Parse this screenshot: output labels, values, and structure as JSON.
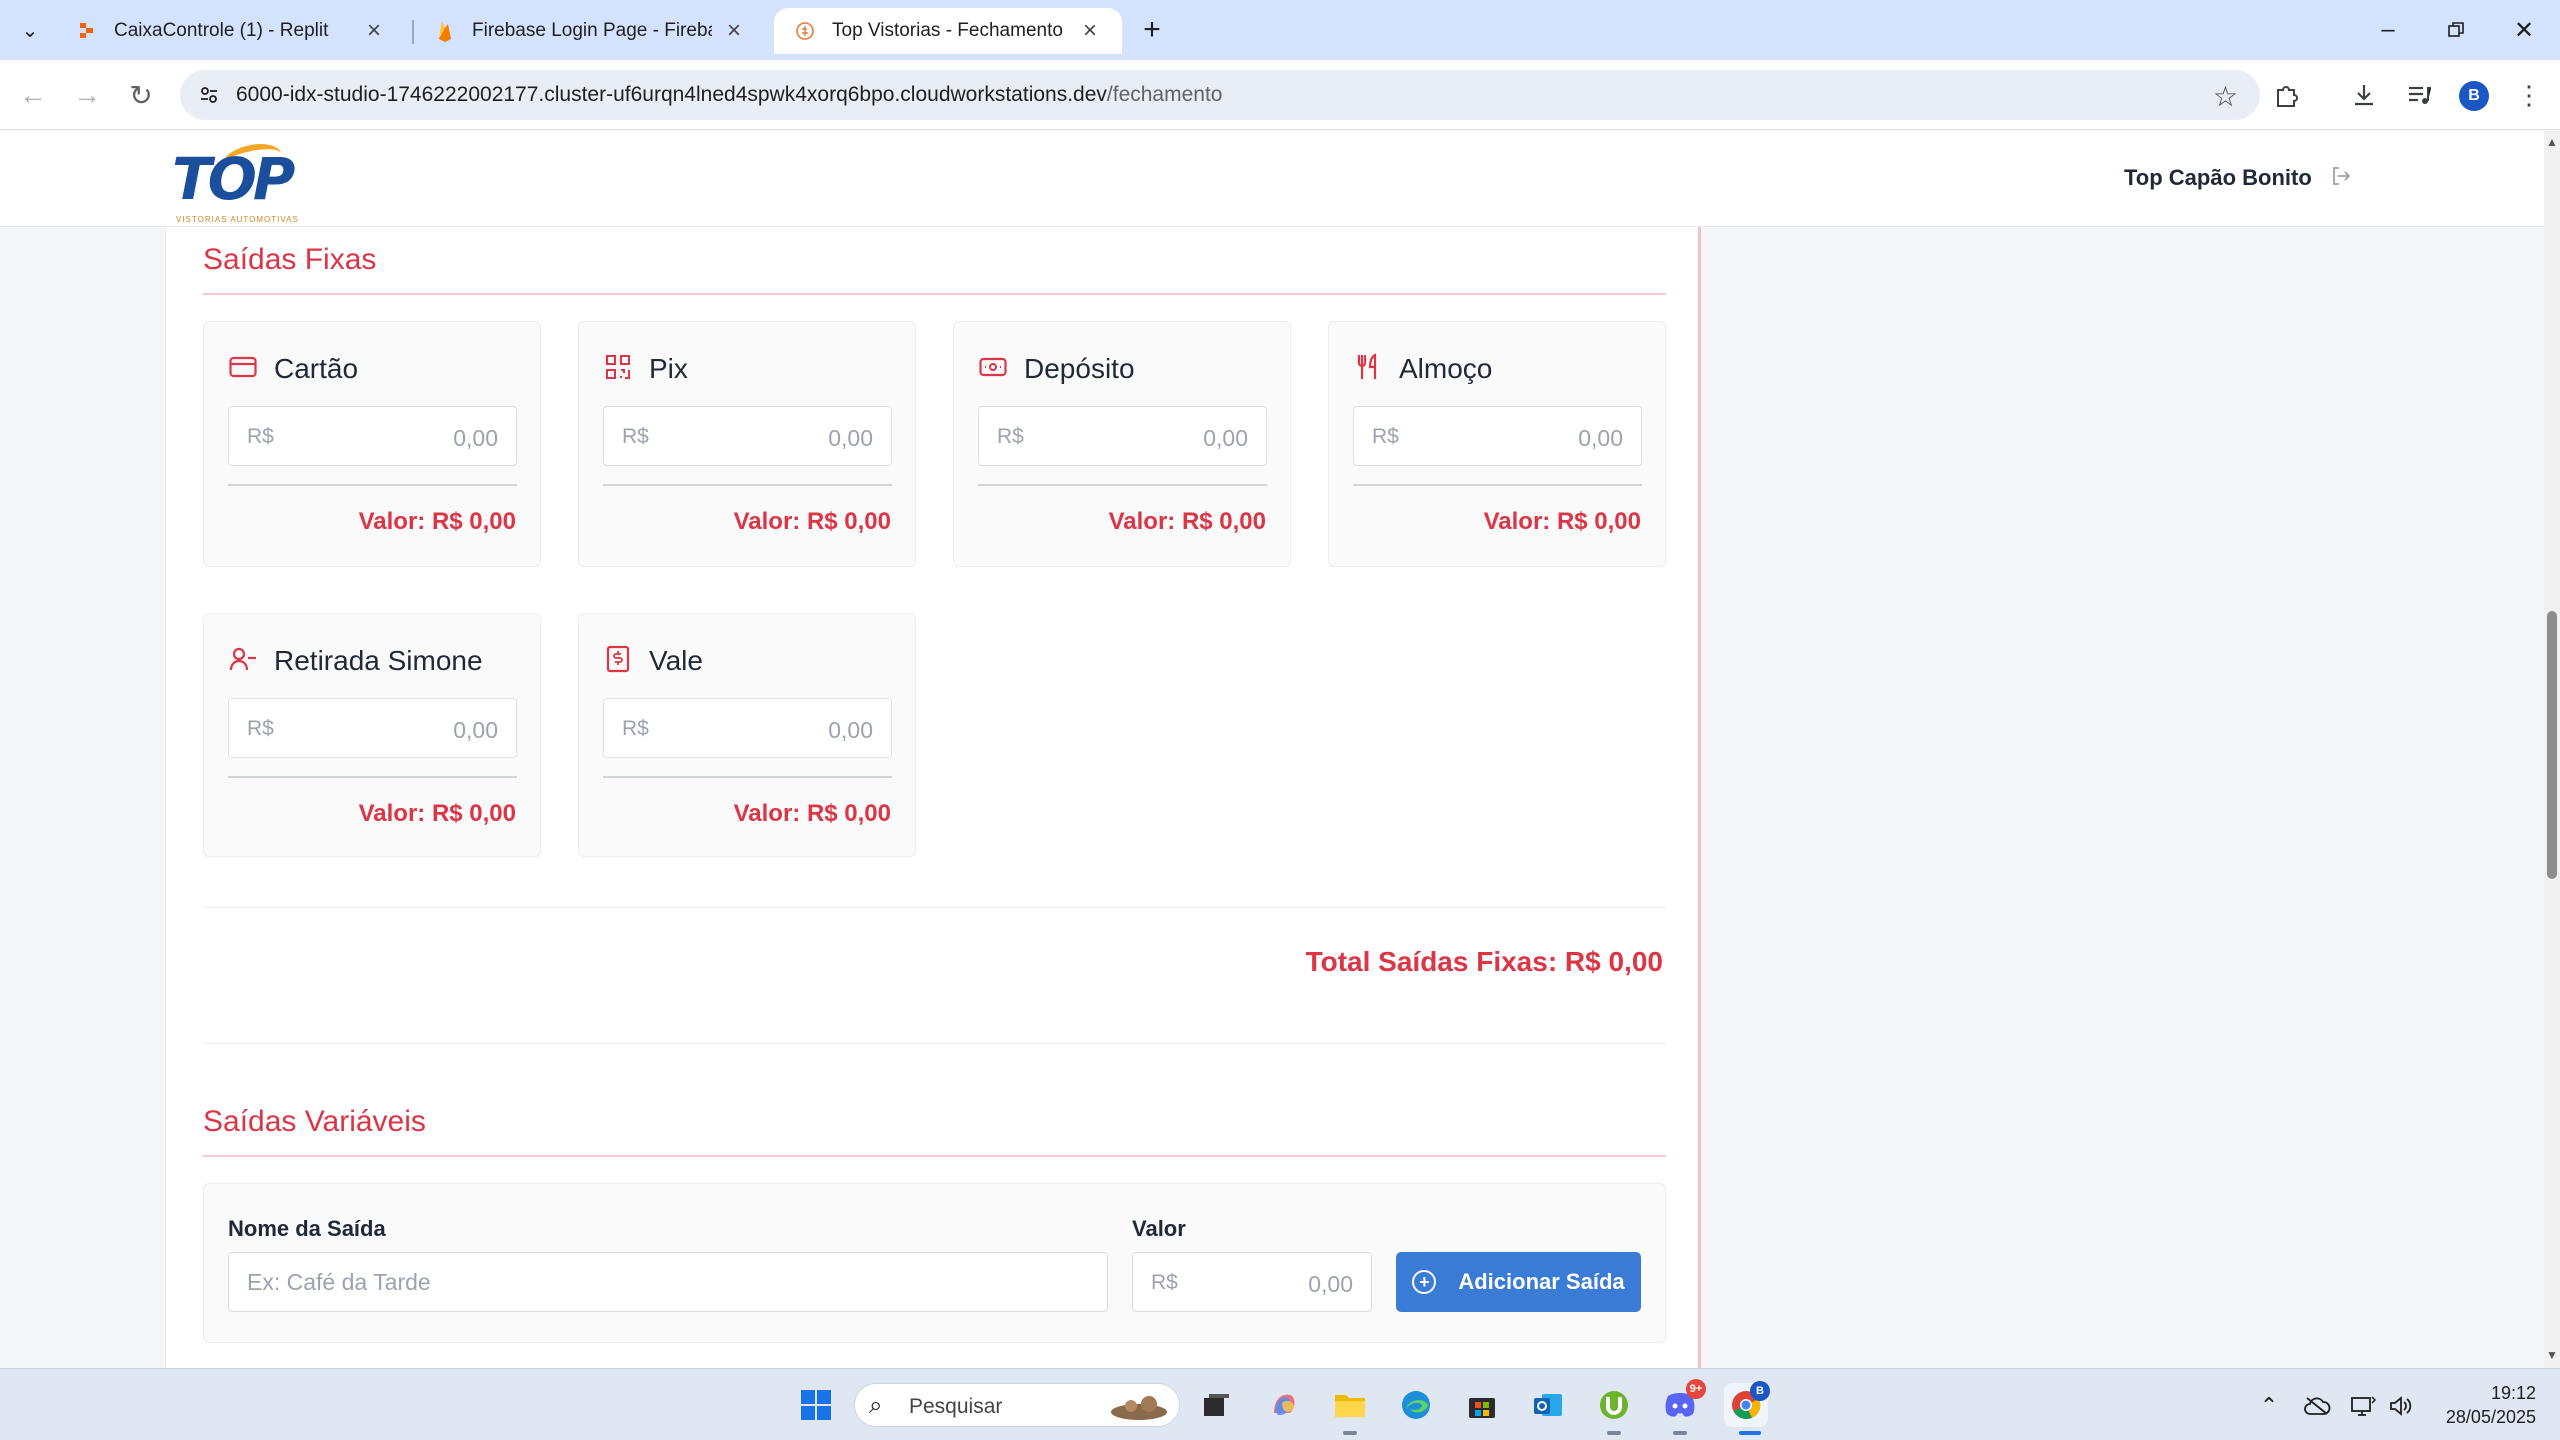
{
  "browser": {
    "tabs": [
      {
        "title": "CaixaControle (1) - Replit",
        "favicon": "replit-icon"
      },
      {
        "title": "Firebase Login Page - Firebase",
        "favicon": "firebase-icon"
      },
      {
        "title": "Top Vistorias - Fechamento de",
        "favicon": "page-icon",
        "active": true
      }
    ],
    "url_host": "6000-idx-studio-1746222002177.cluster-uf6urqn4lned4spwk4xorq6bpo.cloudworkstations.dev",
    "url_path": "/fechamento",
    "profile_initial": "B"
  },
  "header": {
    "logo_text": "TOP",
    "logo_tagline": "VISTORIAS AUTOMOTIVAS",
    "user_name": "Top Capão Bonito"
  },
  "saidas_fixas": {
    "title": "Saídas Fixas",
    "items": [
      {
        "name": "Cartão",
        "icon": "credit-card-icon",
        "currency": "R$",
        "amount": "0,00",
        "valor": "Valor: R$ 0,00"
      },
      {
        "name": "Pix",
        "icon": "qr-code-icon",
        "currency": "R$",
        "amount": "0,00",
        "valor": "Valor: R$ 0,00"
      },
      {
        "name": "Depósito",
        "icon": "banknote-icon",
        "currency": "R$",
        "amount": "0,00",
        "valor": "Valor: R$ 0,00"
      },
      {
        "name": "Almoço",
        "icon": "utensils-icon",
        "currency": "R$",
        "amount": "0,00",
        "valor": "Valor: R$ 0,00"
      },
      {
        "name": "Retirada Simone",
        "icon": "user-minus-icon",
        "currency": "R$",
        "amount": "0,00",
        "valor": "Valor: R$ 0,00"
      },
      {
        "name": "Vale",
        "icon": "receipt-icon",
        "currency": "R$",
        "amount": "0,00",
        "valor": "Valor: R$ 0,00"
      }
    ],
    "total": "Total Saídas Fixas: R$ 0,00"
  },
  "saidas_variaveis": {
    "title": "Saídas Variáveis",
    "name_label": "Nome da Saída",
    "name_placeholder": "Ex: Café da Tarde",
    "value_label": "Valor",
    "currency": "R$",
    "amount": "0,00",
    "add_button": "Adicionar Saída"
  },
  "taskbar": {
    "search_placeholder": "Pesquisar",
    "time": "19:12",
    "date": "28/05/2025",
    "discord_badge": "9+",
    "chrome_badge": "B"
  },
  "colors": {
    "accent_red": "#dc3545",
    "button_blue": "#3a7bd5",
    "logo_blue": "#1b4f9c",
    "logo_orange": "#f5a623"
  }
}
